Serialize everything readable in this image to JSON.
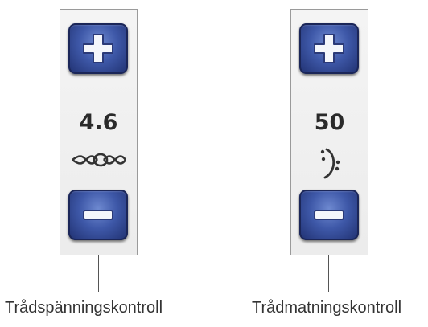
{
  "thread_tension": {
    "value": "4.6",
    "symbol_icon": "thread-tension-icon",
    "caption": "Trådspänningskontroll"
  },
  "thread_feed": {
    "value": "50",
    "symbol_icon": "thread-feed-icon",
    "caption": "Trådmatningskontroll"
  },
  "icons": {
    "increase": "plus-icon",
    "decrease": "minus-icon"
  },
  "colors": {
    "button_blue": "#3e58a8",
    "button_dark": "#1f2f6e",
    "panel_border": "#9a9a9a",
    "value_text": "#2a2a2a"
  }
}
